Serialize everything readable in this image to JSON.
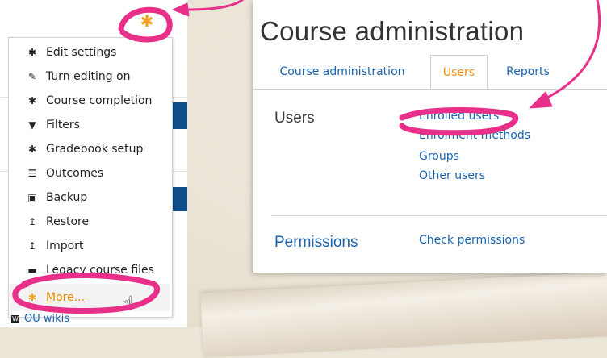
{
  "left_menu": {
    "items": [
      {
        "label": "Edit settings",
        "icon": "gear-icon",
        "glyph": "✱"
      },
      {
        "label": "Turn editing on",
        "icon": "pencil-icon",
        "glyph": "✎"
      },
      {
        "label": "Course completion",
        "icon": "gear-icon",
        "glyph": "✱"
      },
      {
        "label": "Filters",
        "icon": "filter-icon",
        "glyph": "▼"
      },
      {
        "label": "Gradebook setup",
        "icon": "gear-icon",
        "glyph": "✱"
      },
      {
        "label": "Outcomes",
        "icon": "list-icon",
        "glyph": "☰"
      },
      {
        "label": "Backup",
        "icon": "backup-icon",
        "glyph": "▣"
      },
      {
        "label": "Restore",
        "icon": "upload-arrow-icon",
        "glyph": "↥"
      },
      {
        "label": "Import",
        "icon": "upload-arrow-icon",
        "glyph": "↥"
      },
      {
        "label": "Legacy course files",
        "icon": "folder-icon",
        "glyph": "▬"
      },
      {
        "label": "More...",
        "icon": "gear-icon",
        "glyph": "✱"
      }
    ],
    "ou_wikis": "OU wikis"
  },
  "course_admin": {
    "title": "Course administration",
    "tabs": [
      "Course administration",
      "Users",
      "Reports"
    ],
    "active_tab": "Users",
    "sections": [
      {
        "label": "Users",
        "links": [
          "Enrolled users",
          "Enrolment methods",
          "Groups",
          "Other users"
        ]
      },
      {
        "label": "Permissions",
        "links": [
          "Check permissions"
        ]
      }
    ]
  },
  "colors": {
    "accent_orange": "#f29010",
    "link_blue": "#1a64b0",
    "annotation_pink": "#e8308a",
    "band_blue": "#0f4e88"
  }
}
